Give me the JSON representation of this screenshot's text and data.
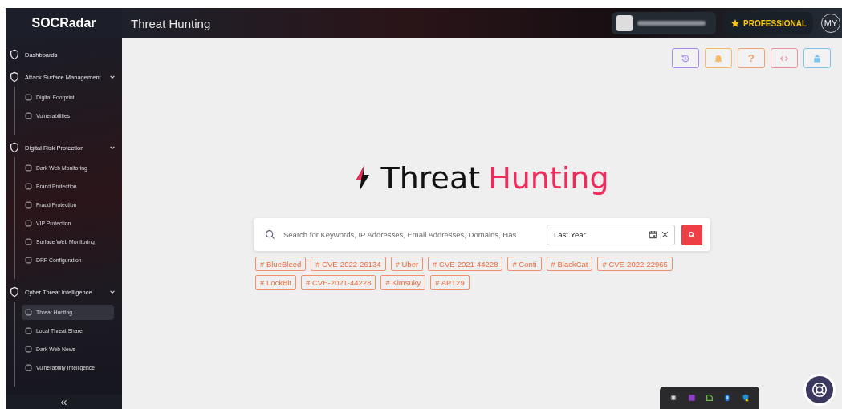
{
  "header": {
    "logo": "SOCRadar",
    "page_title": "Threat Hunting",
    "plan": "PROFESSIONAL",
    "avatar": "MY"
  },
  "sidebar": {
    "groups": [
      {
        "label": "Dashboards"
      },
      {
        "label": "Attack Surface Management",
        "expanded": true,
        "children": [
          {
            "label": "Digital Footprint",
            "selected": false
          },
          {
            "label": "Vulnerabilities",
            "selected": false
          }
        ]
      },
      {
        "label": "Digital Risk Protection",
        "expanded": true,
        "children": [
          {
            "label": "Dark Web Monitoring",
            "selected": false
          },
          {
            "label": "Brand Protection",
            "selected": false
          },
          {
            "label": "Fraud Protection",
            "selected": false
          },
          {
            "label": "VIP Protection",
            "selected": false
          },
          {
            "label": "Surface Web Monitoring",
            "selected": false
          },
          {
            "label": "DRP Configuration",
            "selected": false
          }
        ]
      },
      {
        "label": "Cyber Threat Intelligence",
        "expanded": true,
        "children": [
          {
            "label": "Threat Hunting",
            "selected": true
          },
          {
            "label": "Local Threat Share",
            "selected": false
          },
          {
            "label": "Dark Web News",
            "selected": false
          },
          {
            "label": "Vulnerability Intelligence",
            "selected": false
          }
        ]
      }
    ],
    "collapse": "«"
  },
  "toolbar": [
    {
      "kind": "history",
      "color": "#a98bf0"
    },
    {
      "kind": "bell",
      "color": "#f5b968"
    },
    {
      "kind": "help",
      "color": "#f2a26e",
      "label": "?"
    },
    {
      "kind": "code",
      "color": "#f08f9e"
    },
    {
      "kind": "upload",
      "color": "#7cc3ec"
    }
  ],
  "hero": {
    "title": "Threat",
    "highlight": "Hunting"
  },
  "search": {
    "placeholder": "Search for Keywords, IP Addresses, Email Addresses, Domains, Has",
    "date_range": "Last Year"
  },
  "tags": [
    "# BlueBleed",
    "# CVE-2022-26134",
    "# Uber",
    "# CVE-2021-44228",
    "# Conti",
    "# BlackCat",
    "# CVE-2022-22965",
    "# LockBit",
    "# CVE-2021-44228",
    "# Kimsuky",
    "# APT29"
  ]
}
